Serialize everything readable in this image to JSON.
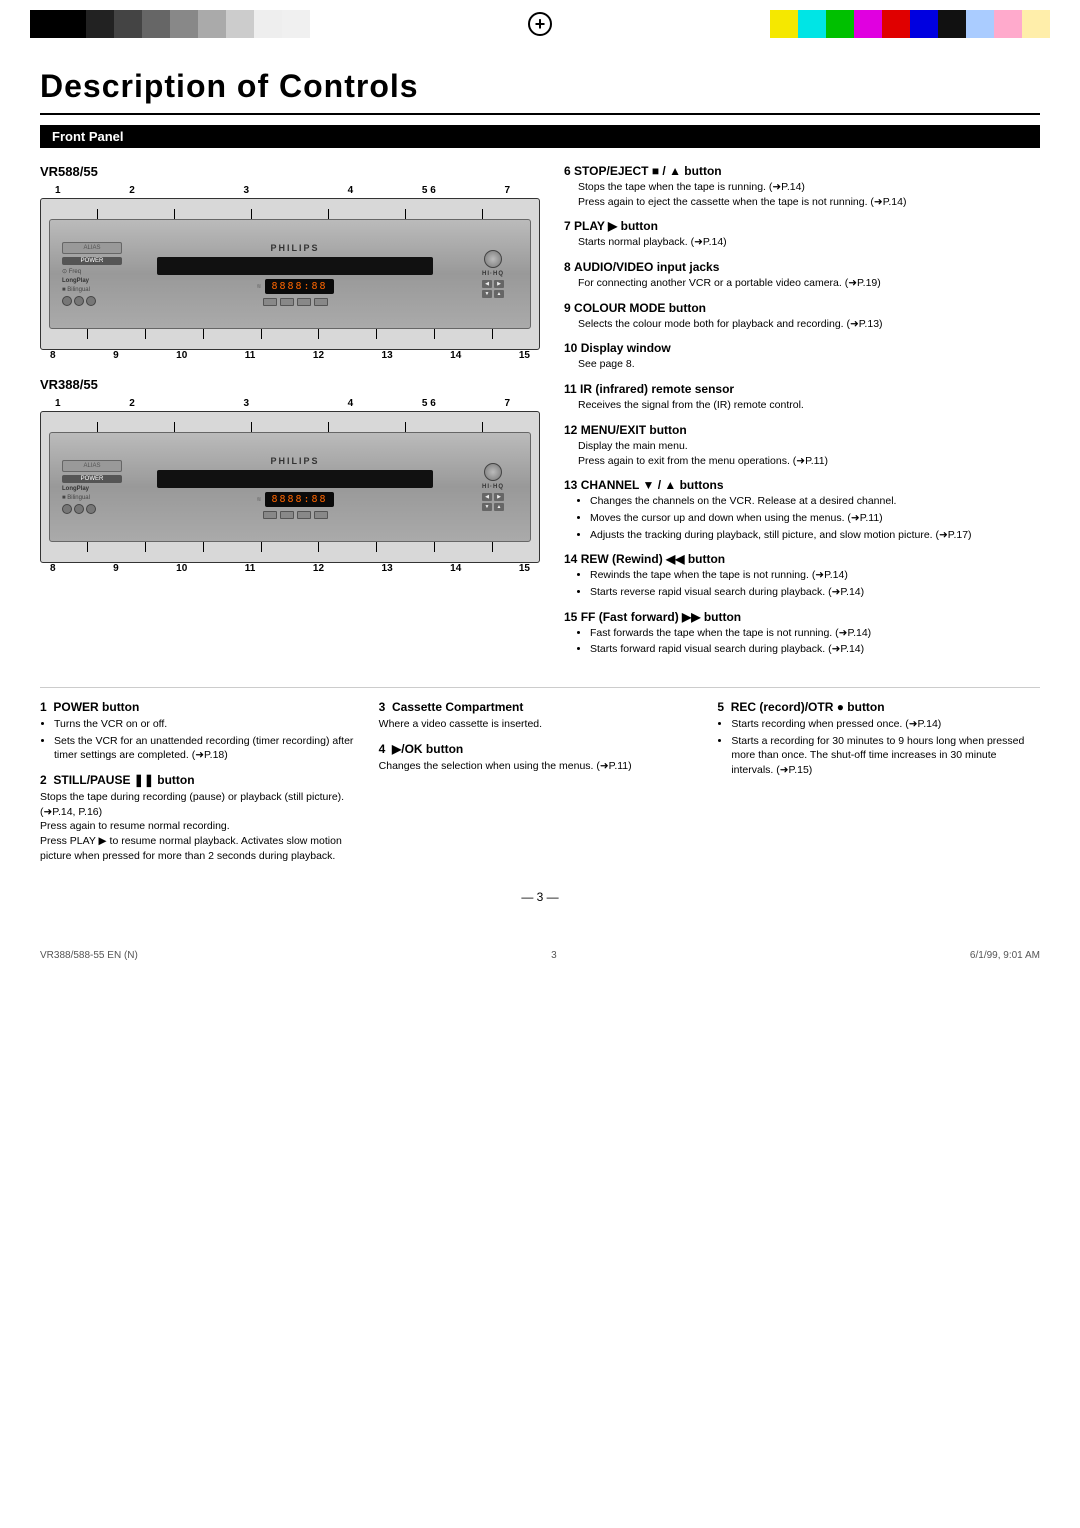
{
  "header": {
    "title": "Description of Controls",
    "title_d": "D",
    "title_rest1": "escription of ",
    "title_c": "C",
    "title_rest2": "ontrols"
  },
  "section": {
    "front_panel": "Front Panel"
  },
  "vcr_models": [
    {
      "id": "vr588",
      "label": "VR588/55"
    },
    {
      "id": "vr388",
      "label": "VR388/55"
    }
  ],
  "vcr_display_text": "8888:88",
  "vcr_brand": "PHILIPS",
  "number_labels_top": [
    "1",
    "2",
    "3",
    "4",
    "5 6",
    "7"
  ],
  "number_labels_bottom": [
    "8",
    "9",
    "10",
    "11",
    "12",
    "13",
    "14",
    "15"
  ],
  "descriptions": [
    {
      "num": "6",
      "title": "STOP/EJECT ■ / ▲ button",
      "body": "Stops the tape when the tape is running. (➜P.14)\nPress again to eject the cassette when the tape is not running. (➜P.14)"
    },
    {
      "num": "7",
      "title": "PLAY ▶ button",
      "body": "Starts normal playback. (➜P.14)"
    },
    {
      "num": "8",
      "title": "AUDIO/VIDEO input jacks",
      "body": "For connecting another VCR or a portable video camera. (➜P.19)"
    },
    {
      "num": "9",
      "title": "COLOUR MODE button",
      "body": "Selects the colour mode both for playback and recording. (➜P.13)"
    },
    {
      "num": "10",
      "title": "Display window",
      "body": "See page 8."
    },
    {
      "num": "11",
      "title": "IR (infrared) remote sensor",
      "body": "Receives the signal from the (IR) remote control."
    },
    {
      "num": "12",
      "title": "MENU/EXIT button",
      "body": "Display the main menu.\nPress again to exit from the menu operations. (➜P.11)"
    },
    {
      "num": "13",
      "title": "CHANNEL ▼ / ▲ buttons",
      "bullets": [
        "Changes the channels on the VCR. Release at a desired channel.",
        "Moves the cursor up and down when using the menus. (➜P.11)",
        "Adjusts the tracking during playback, still picture, and slow motion picture. (➜P.17)"
      ]
    },
    {
      "num": "14",
      "title": "REW (Rewind) ◀◀ button",
      "bullets": [
        "Rewinds the tape when the tape is not running. (➜P.14)",
        "Starts reverse rapid visual search during playback. (➜P.14)"
      ]
    },
    {
      "num": "15",
      "title": "FF (Fast forward) ▶▶ button",
      "bullets": [
        "Fast forwards the tape when the tape is not running. (➜P.14)",
        "Starts forward rapid visual search during playback. (➜P.14)"
      ]
    }
  ],
  "bottom_controls": [
    {
      "num": "1",
      "title": "POWER button",
      "bullets": [
        "Turns the VCR on or off.",
        "Sets the VCR for an unattended recording (timer recording) after timer settings are completed. (➜P.18)"
      ]
    },
    {
      "num": "2",
      "title": "STILL/PAUSE ❚❚ button",
      "body": "Stops the tape during recording (pause) or playback (still picture). (➜P.14, P.16)\nPress again to resume normal recording.\nPress PLAY ▶ to resume normal playback. Activates slow motion picture when pressed for more than 2 seconds during playback."
    },
    {
      "num": "3",
      "title": "Cassette Compartment",
      "body": "Where a video cassette is inserted."
    },
    {
      "num": "4",
      "title": "▶/OK button",
      "body": "Changes the selection when using the menus. (➜P.11)"
    },
    {
      "num": "5",
      "title": "REC (record)/OTR ● button",
      "bullets": [
        "Starts recording when pressed once. (➜P.14)",
        "Starts a recording for 30 minutes to 9 hours long when pressed more than once. The shut-off time increases in 30 minute intervals. (➜P.15)"
      ]
    }
  ],
  "footer": {
    "left": "VR388/588-55 EN (N)",
    "center": "3",
    "right": "6/1/99, 9:01 AM"
  },
  "grayscale_bars": [
    "#000",
    "#1a1a1a",
    "#333",
    "#4d4d4d",
    "#666",
    "#808080",
    "#999",
    "#b3b3b3",
    "#ccc",
    "#e6e6e6",
    "#fff"
  ],
  "color_bars": [
    "#ffff00",
    "#00ffff",
    "#00c000",
    "#ff00ff",
    "#ff0000",
    "#0000ff",
    "#000000",
    "#aaccff",
    "#ffaacc",
    "#ffccaa"
  ]
}
